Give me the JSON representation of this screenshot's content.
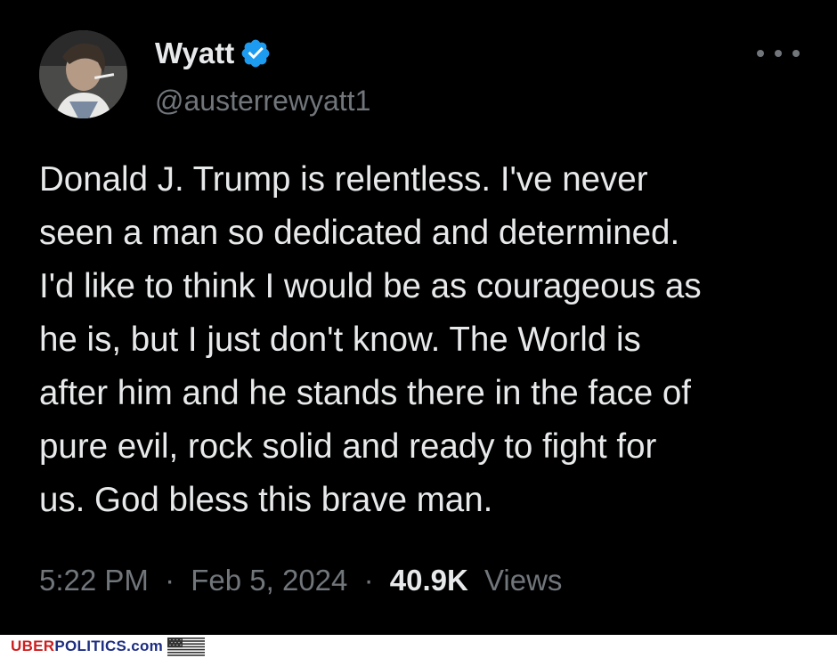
{
  "tweet": {
    "display_name": "Wyatt",
    "handle": "@austerrewyatt1",
    "text": "Donald J. Trump is relentless. I've never\nseen a man so dedicated and determined.\nI'd like to think I would be as courageous as\nhe is, but I just don't know. The World is\nafter him and he stands there in the face of\npure evil, rock solid and ready to fight for\nus. God bless this brave man.",
    "time": "5:22 PM",
    "separator": "·",
    "date": "Feb 5, 2024",
    "views_count": "40.9K",
    "views_label": "Views",
    "verified_icon": "verified-badge-icon",
    "more_icon": "more-dots-icon"
  },
  "watermark": {
    "brand_part1": "UBER",
    "brand_part2": "POLITICS.com",
    "flag_icon": "us-flag-icon"
  },
  "colors": {
    "background": "#000000",
    "text_primary": "#e7e9ea",
    "text_secondary": "#71767b",
    "verified_blue": "#1d9bf0",
    "brand_red": "#cc1f1f",
    "brand_blue": "#1d2e82"
  }
}
